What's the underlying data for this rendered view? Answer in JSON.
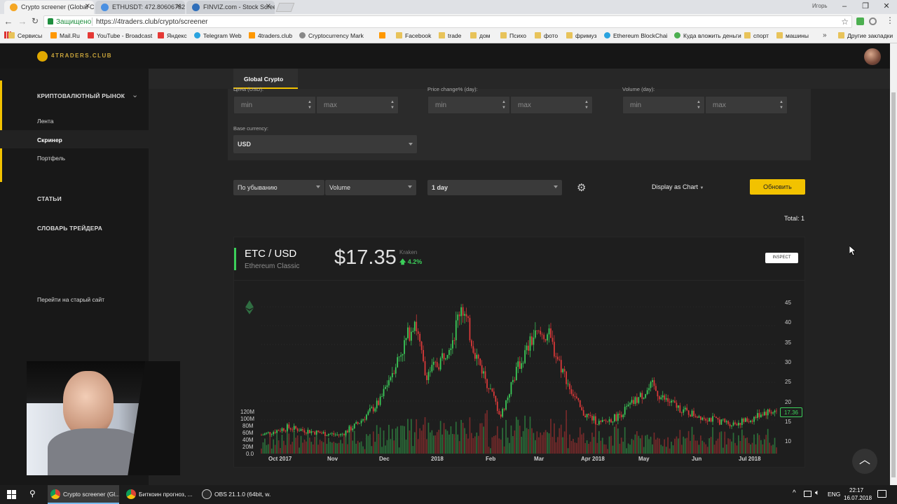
{
  "browser": {
    "tabs": [
      {
        "title": "Crypto screener (Global C",
        "icon_color": "#f5a623"
      },
      {
        "title": "ETHUSDT: 472.80606782",
        "icon_color": "#4a90e2"
      },
      {
        "title": "FINVIZ.com - Stock Scree",
        "icon_color": "#2f6fba"
      }
    ],
    "user_label": "Игорь",
    "secure_label": "Защищено",
    "url": "https://4traders.club/crypto/screener",
    "bookmarks": [
      "Сервисы",
      "Mail.Ru",
      "YouTube - Broadcast",
      "Яндекс",
      "Telegram Web",
      "4traders.club",
      "Cryptocurrency Mark",
      "",
      "Facebook",
      "trade",
      "дом",
      "Психо",
      "фото",
      "фримуз",
      "Ethereum BlockChai",
      "Куда вложить деньги",
      "спорт",
      "машины"
    ],
    "bookmarks_more": "»",
    "other_bookmarks": "Другие закладки"
  },
  "site": {
    "logo_text": "4TRADERS.CLUB",
    "brand_color": "#f2c200",
    "up_color": "#3ccf5a",
    "down_color": "#e03a3a"
  },
  "sidebar": {
    "market_label": "КРИПТОВАЛЮТНЫЙ РЫНОК",
    "items": [
      "Лента",
      "Скринер",
      "Портфель"
    ],
    "articles": "СТАТЬИ",
    "dictionary": "СЛОВАРЬ ТРЕЙДЕРА",
    "old_site": "Перейти на старый сайт"
  },
  "filters": {
    "tab": "Global Crypto",
    "price_label": "Цена (USD):",
    "change_label": "Price change% (day):",
    "volume_label": "Volume (day):",
    "min_placeholder": "min",
    "max_placeholder": "max",
    "base_currency_label": "Base currency:",
    "base_currency": "USD"
  },
  "controls": {
    "sort_order": "По убыванию",
    "sort_field": "Volume",
    "period": "1 day",
    "display": "Display as Chart",
    "refresh": "Обновить",
    "total": "Total: 1"
  },
  "card": {
    "pair": "ETC / USD",
    "name": "Ethereum Classic",
    "price": "$17.35",
    "exchange": "Kraken",
    "change": "4.2%",
    "inspect": "INSPECT"
  },
  "chart_data": {
    "type": "candlestick",
    "price_ticks": [
      "45",
      "40",
      "35",
      "30",
      "25",
      "20",
      "15",
      "10"
    ],
    "volume_ticks": [
      "120M",
      "100M",
      "80M",
      "60M",
      "40M",
      "20M",
      "0.0"
    ],
    "x_ticks": [
      "Oct 2017",
      "Nov",
      "Dec",
      "2018",
      "Feb",
      "Mar",
      "Apr 2018",
      "May",
      "Jun",
      "Jul 2018"
    ],
    "last_price_label": "17.36",
    "y_range": [
      7,
      46
    ],
    "approx_close_path": [
      {
        "date": "2017-09-20",
        "close": 11
      },
      {
        "date": "2017-10-05",
        "close": 13
      },
      {
        "date": "2017-10-25",
        "close": 11.5
      },
      {
        "date": "2017-11-05",
        "close": 11
      },
      {
        "date": "2017-11-15",
        "close": 14
      },
      {
        "date": "2017-11-28",
        "close": 20
      },
      {
        "date": "2017-12-05",
        "close": 28
      },
      {
        "date": "2017-12-12",
        "close": 35
      },
      {
        "date": "2017-12-18",
        "close": 42
      },
      {
        "date": "2017-12-24",
        "close": 27
      },
      {
        "date": "2018-01-01",
        "close": 30
      },
      {
        "date": "2018-01-10",
        "close": 38
      },
      {
        "date": "2018-01-14",
        "close": 46
      },
      {
        "date": "2018-01-22",
        "close": 33
      },
      {
        "date": "2018-02-06",
        "close": 16
      },
      {
        "date": "2018-02-15",
        "close": 28
      },
      {
        "date": "2018-02-25",
        "close": 37
      },
      {
        "date": "2018-03-05",
        "close": 38
      },
      {
        "date": "2018-03-15",
        "close": 27
      },
      {
        "date": "2018-03-25",
        "close": 17
      },
      {
        "date": "2018-04-05",
        "close": 14
      },
      {
        "date": "2018-04-15",
        "close": 16
      },
      {
        "date": "2018-04-25",
        "close": 20
      },
      {
        "date": "2018-05-05",
        "close": 24
      },
      {
        "date": "2018-05-10",
        "close": 21
      },
      {
        "date": "2018-05-25",
        "close": 17
      },
      {
        "date": "2018-06-10",
        "close": 15
      },
      {
        "date": "2018-06-20",
        "close": 14
      },
      {
        "date": "2018-07-01",
        "close": 15
      },
      {
        "date": "2018-07-08",
        "close": 17
      },
      {
        "date": "2018-07-16",
        "close": 17.36
      }
    ]
  },
  "taskbar": {
    "apps": [
      "Crypto screener (Gl...",
      "Биткоин прогноз, ...",
      "OBS 21.1.0 (64bit, w..."
    ],
    "lang": "ENG",
    "time": "22:17",
    "date": "16.07.2018"
  }
}
